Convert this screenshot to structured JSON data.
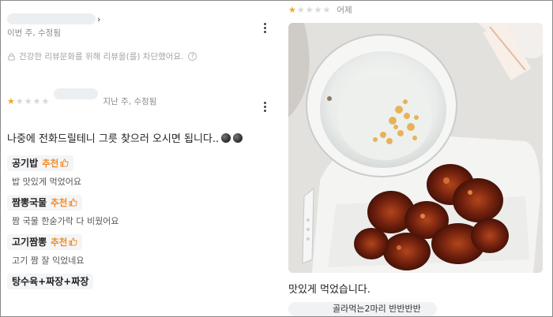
{
  "left_panel": {
    "review1": {
      "meta": "이번 주, 수정됨",
      "blocked_notice": "건강한 리뷰문화를 위해 리뷰을(를) 차단했어요.",
      "help_icon": "?"
    },
    "review2": {
      "rating": 1,
      "max_rating": 5,
      "meta": "지난 주, 수정됨",
      "comment": "나중에 전화드릴테니 그릇 찾으러 오시면 됩니다..",
      "items": [
        {
          "name": "공기밥",
          "recommend": "추천",
          "text": "밥 맛있게 먹었어요"
        },
        {
          "name": "짬뽕국물",
          "recommend": "추천",
          "text": "짬 국물 한숟가락 다 비웠어요"
        },
        {
          "name": "고기짬뽕",
          "recommend": "추천",
          "text": "고기 짬 잘 익었네요"
        }
      ],
      "order_tag": "탕수육+짜장+짜장"
    }
  },
  "right_panel": {
    "rating": 1,
    "max_rating": 5,
    "date": "어제",
    "caption": "맛있게 먹었습니다.",
    "menu_tag": "골라먹는2마리 반반반반"
  },
  "colors": {
    "star_on": "#f5a623",
    "star_off": "#d7d7d7",
    "recommend": "#f08a24",
    "tag_bg": "#f4f5f7"
  },
  "icons": [
    "lock-icon",
    "help-icon",
    "more-icon",
    "thumbs-up-icon",
    "star-icon",
    "chevron-right-icon"
  ]
}
